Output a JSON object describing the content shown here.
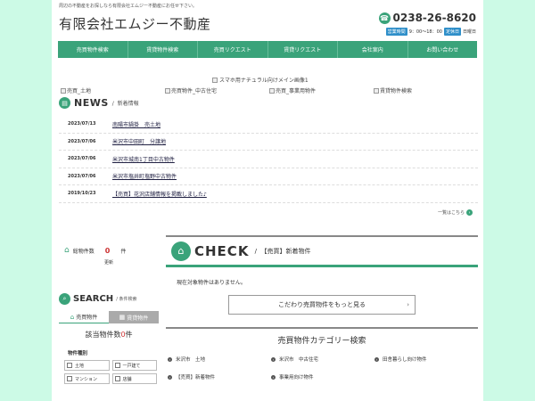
{
  "header": {
    "tagline": "周辺の不動産をお探しなら有限会社エムジー不動産にお任せ下さい。",
    "title": "有限会社エムジー不動産",
    "phone": "0238-26-8620",
    "hours_tag": "営業時間",
    "hours": "9：00～18：00",
    "holiday_tag": "定休日",
    "holiday": "日曜日"
  },
  "nav": {
    "items": [
      "売買物件検索",
      "賃貸物件検索",
      "売買リクエスト",
      "賃貸リクエスト",
      "会社案内",
      "お問い合わせ"
    ]
  },
  "hero": {
    "alt": "スマホ用ナチュラル向けメイン画像1"
  },
  "banners": [
    "売買_土地",
    "売買物件_中古住宅",
    "売買_事業用物件",
    "賃貸物件検索"
  ],
  "news": {
    "title": "NEWS",
    "subtitle": "新着情報",
    "items": [
      {
        "date": "2023/07/13",
        "text": "南陽市鍋掛　売土地"
      },
      {
        "date": "2023/07/06",
        "text": "米沢市中田町　分譲地"
      },
      {
        "date": "2023/07/06",
        "text": "米沢市城南1丁目中古物件"
      },
      {
        "date": "2023/07/06",
        "text": "米沢市塩井町塩野中古物件"
      },
      {
        "date": "2019/10/23",
        "text": "【売買】花沢店舗情報を掲載しました♪"
      }
    ],
    "more": "一覧はこちら"
  },
  "count": {
    "label": "総物件数",
    "value": "0",
    "unit": "件",
    "update": "更新"
  },
  "check": {
    "title": "CHECK",
    "subtitle": "【売買】新着物件",
    "empty": "現在対象物件はありません。",
    "more_button": "こだわり売買物件をもっと見る"
  },
  "category": {
    "title": "売買物件カテゴリー検索",
    "items": [
      "米沢市　土地",
      "米沢市　中古住宅",
      "田舎暮らし向け物件",
      "【売買】新着物件",
      "事業用向け物件"
    ]
  },
  "search": {
    "title": "SEARCH",
    "subtitle": "条件検索",
    "tab_sale": "売買物件",
    "tab_rent": "賃貸物件",
    "hit_label": "該当物件数",
    "hit_value": "0",
    "hit_unit": "件",
    "type_label": "物件種別",
    "types": [
      "土地",
      "一戸建て",
      "マンション",
      "店舗"
    ]
  }
}
